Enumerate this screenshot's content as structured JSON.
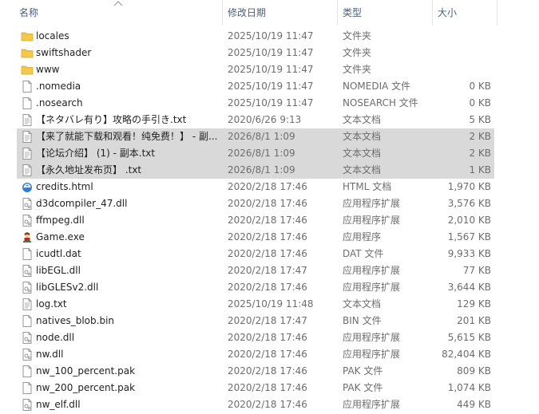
{
  "header": {
    "col_name": "名称",
    "col_date": "修改日期",
    "col_type": "类型",
    "col_size": "大小"
  },
  "files": [
    {
      "name": "locales",
      "date": "2025/10/19 11:47",
      "type": "文件夹",
      "size": "",
      "icon": "folder-icon",
      "selected": false
    },
    {
      "name": "swiftshader",
      "date": "2025/10/19 11:47",
      "type": "文件夹",
      "size": "",
      "icon": "folder-icon",
      "selected": false
    },
    {
      "name": "www",
      "date": "2025/10/19 11:47",
      "type": "文件夹",
      "size": "",
      "icon": "folder-icon",
      "selected": false
    },
    {
      "name": ".nomedia",
      "date": "2025/10/19 11:47",
      "type": "NOMEDIA 文件",
      "size": "0 KB",
      "icon": "file-icon",
      "selected": false
    },
    {
      "name": ".nosearch",
      "date": "2025/10/19 11:47",
      "type": "NOSEARCH 文件",
      "size": "0 KB",
      "icon": "file-icon",
      "selected": false
    },
    {
      "name": "【ネタバレ有り】攻略の手引き.txt",
      "date": "2020/6/26 9:13",
      "type": "文本文档",
      "size": "5 KB",
      "icon": "text-file-icon",
      "selected": false
    },
    {
      "name": "【来了就能下载和观看！纯免费！】 - 副...",
      "date": "2026/8/1 1:09",
      "type": "文本文档",
      "size": "2 KB",
      "icon": "text-file-icon",
      "selected": true
    },
    {
      "name": "【论坛介绍】 (1) - 副本.txt",
      "date": "2026/8/1 1:09",
      "type": "文本文档",
      "size": "2 KB",
      "icon": "text-file-icon",
      "selected": true
    },
    {
      "name": "【永久地址发布页】 .txt",
      "date": "2026/8/1 1:09",
      "type": "文本文档",
      "size": "1 KB",
      "icon": "text-file-icon",
      "selected": true
    },
    {
      "name": "credits.html",
      "date": "2020/2/18 17:46",
      "type": "HTML 文档",
      "size": "1,970 KB",
      "icon": "browser-icon",
      "selected": false
    },
    {
      "name": "d3dcompiler_47.dll",
      "date": "2020/2/18 17:46",
      "type": "应用程序扩展",
      "size": "3,576 KB",
      "icon": "dll-file-icon",
      "selected": false
    },
    {
      "name": "ffmpeg.dll",
      "date": "2020/2/18 17:46",
      "type": "应用程序扩展",
      "size": "2,010 KB",
      "icon": "dll-file-icon",
      "selected": false
    },
    {
      "name": "Game.exe",
      "date": "2020/2/18 17:46",
      "type": "应用程序",
      "size": "1,567 KB",
      "icon": "game-app-icon",
      "selected": false
    },
    {
      "name": "icudtl.dat",
      "date": "2020/2/18 17:46",
      "type": "DAT 文件",
      "size": "9,933 KB",
      "icon": "file-icon",
      "selected": false
    },
    {
      "name": "libEGL.dll",
      "date": "2020/2/18 17:47",
      "type": "应用程序扩展",
      "size": "77 KB",
      "icon": "dll-file-icon",
      "selected": false
    },
    {
      "name": "libGLESv2.dll",
      "date": "2020/2/18 17:46",
      "type": "应用程序扩展",
      "size": "3,644 KB",
      "icon": "dll-file-icon",
      "selected": false
    },
    {
      "name": "log.txt",
      "date": "2025/10/19 11:48",
      "type": "文本文档",
      "size": "129 KB",
      "icon": "text-file-icon",
      "selected": false
    },
    {
      "name": "natives_blob.bin",
      "date": "2020/2/18 17:47",
      "type": "BIN 文件",
      "size": "201 KB",
      "icon": "file-icon",
      "selected": false
    },
    {
      "name": "node.dll",
      "date": "2020/2/18 17:46",
      "type": "应用程序扩展",
      "size": "5,615 KB",
      "icon": "dll-file-icon",
      "selected": false
    },
    {
      "name": "nw.dll",
      "date": "2020/2/18 17:46",
      "type": "应用程序扩展",
      "size": "82,404 KB",
      "icon": "dll-file-icon",
      "selected": false
    },
    {
      "name": "nw_100_percent.pak",
      "date": "2020/2/18 17:46",
      "type": "PAK 文件",
      "size": "809 KB",
      "icon": "file-icon",
      "selected": false
    },
    {
      "name": "nw_200_percent.pak",
      "date": "2020/2/18 17:46",
      "type": "PAK 文件",
      "size": "1,074 KB",
      "icon": "file-icon",
      "selected": false
    },
    {
      "name": "nw_elf.dll",
      "date": "2020/2/18 17:46",
      "type": "应用程序扩展",
      "size": "449 KB",
      "icon": "dll-file-icon",
      "selected": false
    }
  ],
  "colors": {
    "header_text": "#4c607a",
    "selection": "#d9d9d9",
    "folder": "#f5c94c",
    "secondary_text": "#6d6d6d"
  }
}
